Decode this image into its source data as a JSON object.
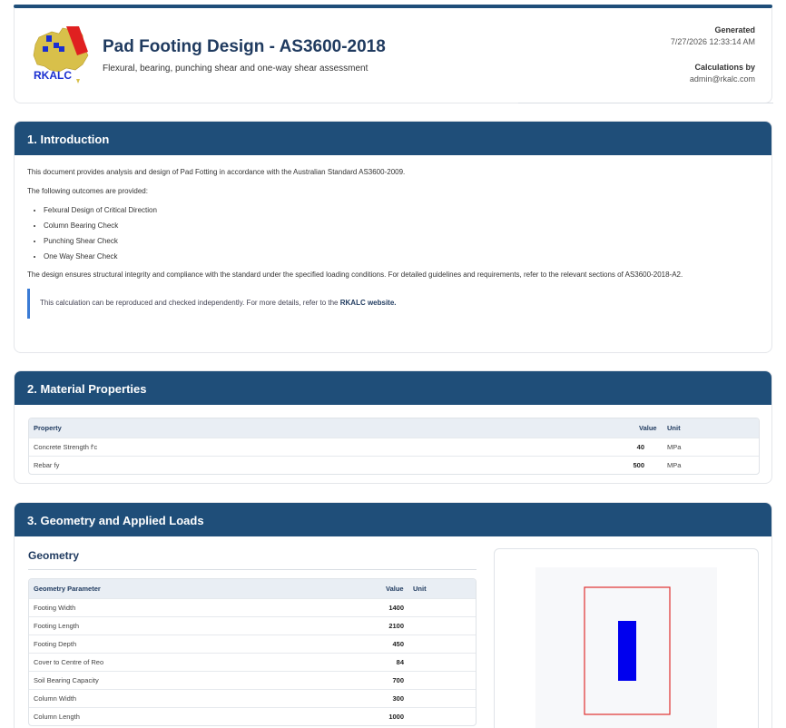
{
  "header": {
    "logo_text": "RKALC",
    "title": "Pad Footing Design - AS3600-2018",
    "subtitle": "Flexural, bearing, punching shear and one-way shear assessment",
    "generated_label": "Generated",
    "generated_value": "7/27/2026 12:33:14 AM",
    "calc_by_label": "Calculations by",
    "calc_by_value": "admin@rkalc.com"
  },
  "intro": {
    "heading": "1. Introduction",
    "para1": "This document provides analysis and design of Pad Fotting in accordance with the Australian Standard AS3600-2009.",
    "para2": "The following outcomes are provided:",
    "items": [
      "Felxural Design of Critical Direction",
      "Column Bearing Check",
      "Punching Shear Check",
      "One Way Shear Check"
    ],
    "para3": "The design ensures structural integrity and compliance with the standard under the specified loading conditions. For detailed guidelines and requirements, refer to the relevant sections of AS3600-2018-A2.",
    "note_text": "This calculation can be reproduced and checked independently. For more details, refer to the",
    "note_link": "RKALC website."
  },
  "materials": {
    "heading": "2. Material Properties",
    "headers": {
      "property": "Property",
      "value": "Value",
      "unit": "Unit"
    },
    "rows": [
      {
        "property": "Concrete Strength f'c",
        "value": "40",
        "unit": "MPa"
      },
      {
        "property": "Rebar fy",
        "value": "500",
        "unit": "MPa"
      }
    ]
  },
  "geometry": {
    "heading": "3. Geometry and Applied Loads",
    "sub_heading": "Geometry",
    "headers": {
      "param": "Geometry Parameter",
      "value": "Value",
      "unit": "Unit"
    },
    "rows": [
      {
        "param": "Footing Width",
        "value": "1400",
        "unit": ""
      },
      {
        "param": "Footing Length",
        "value": "2100",
        "unit": ""
      },
      {
        "param": "Footing Depth",
        "value": "450",
        "unit": ""
      },
      {
        "param": "Cover to Centre of Reo",
        "value": "84",
        "unit": ""
      },
      {
        "param": "Soil Bearing Capacity",
        "value": "700",
        "unit": ""
      },
      {
        "param": "Column Width",
        "value": "300",
        "unit": ""
      },
      {
        "param": "Column Length",
        "value": "1000",
        "unit": ""
      }
    ]
  },
  "colors": {
    "brand": "#1f4e79",
    "footing_outline": "#e03030",
    "column_fill": "#0000ee"
  }
}
